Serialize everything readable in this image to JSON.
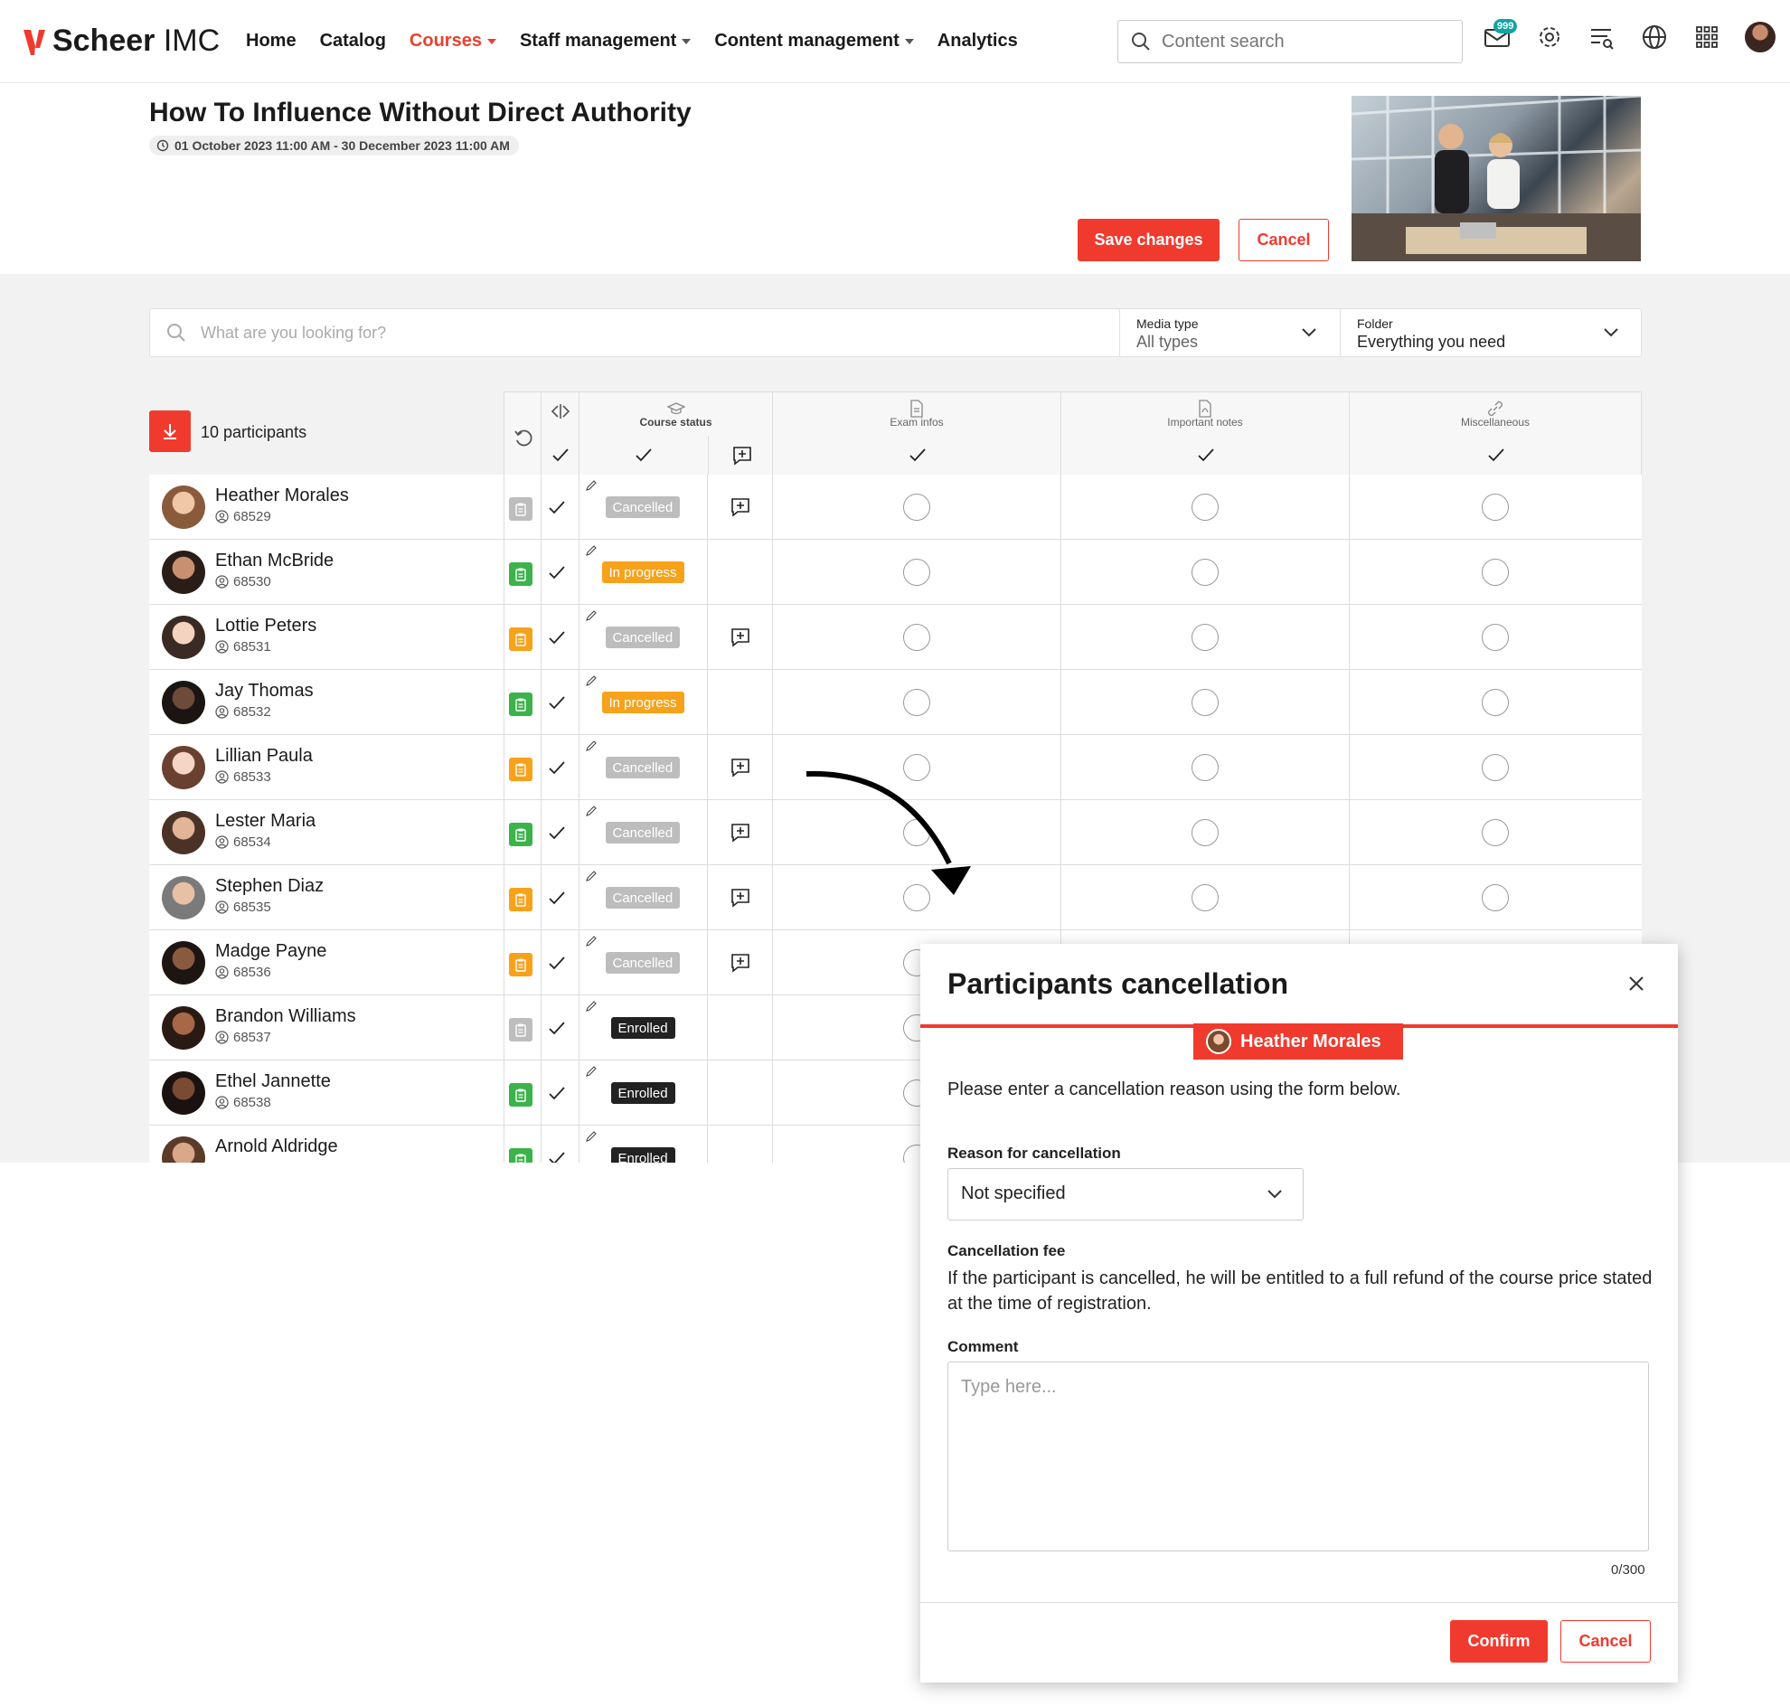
{
  "app": {
    "brand_bold": "Scheer",
    "brand_thin": "IMC",
    "accent": "#f03a2e"
  },
  "nav": [
    "Home",
    "Catalog",
    "Courses",
    "Staff management",
    "Content management",
    "Analytics"
  ],
  "search": {
    "placeholder": "Content search"
  },
  "notifications_badge": "999",
  "course": {
    "title": "How To Influence Without Direct Authority",
    "dates": "01 October 2023 11:00 AM - 30 December 2023 11:00 AM",
    "save_label": "Save changes",
    "cancel_label": "Cancel"
  },
  "filter": {
    "placeholder": "What are you looking for?",
    "media_label": "Media type",
    "media_value": "All types",
    "folder_label": "Folder",
    "folder_value": "Everything you need"
  },
  "participants_count": "10 participants",
  "columns": {
    "status": "Course status",
    "exam": "Exam infos",
    "notes": "Important notes",
    "misc": "Miscellaneous"
  },
  "participants": [
    {
      "name": "Heather Morales",
      "id": "68529",
      "status": "Cancelled",
      "clip": "grey",
      "note": true
    },
    {
      "name": "Ethan McBride",
      "id": "68530",
      "status": "In progress",
      "clip": "green",
      "note": false
    },
    {
      "name": "Lottie Peters",
      "id": "68531",
      "status": "Cancelled",
      "clip": "orange",
      "note": true
    },
    {
      "name": "Jay Thomas",
      "id": "68532",
      "status": "In progress",
      "clip": "green",
      "note": false
    },
    {
      "name": "Lillian Paula",
      "id": "68533",
      "status": "Cancelled",
      "clip": "orange",
      "note": true
    },
    {
      "name": "Lester Maria",
      "id": "68534",
      "status": "Cancelled",
      "clip": "green",
      "note": true
    },
    {
      "name": "Stephen Diaz",
      "id": "68535",
      "status": "Cancelled",
      "clip": "orange",
      "note": true
    },
    {
      "name": "Madge Payne",
      "id": "68536",
      "status": "Cancelled",
      "clip": "orange",
      "note": true
    },
    {
      "name": "Brandon Williams",
      "id": "68537",
      "status": "Enrolled",
      "clip": "grey",
      "note": false
    },
    {
      "name": "Ethel Jannette",
      "id": "68538",
      "status": "Enrolled",
      "clip": "green",
      "note": false
    },
    {
      "name": "Arnold Aldridge",
      "id": "",
      "status": "Enrolled",
      "clip": "green",
      "note": false
    }
  ],
  "modal": {
    "title": "Participants cancellation",
    "participant": "Heather Morales",
    "intro": "Please enter a cancellation reason using the form below.",
    "reason_label": "Reason for cancellation",
    "reason_value": "Not specified",
    "fee_label": "Cancellation fee",
    "fee_text": "If the participant is cancelled, he will be entitled to a full refund of the course price stated at the time of registration.",
    "comment_label": "Comment",
    "comment_placeholder": "Type here...",
    "comment_count": "0/300",
    "confirm_label": "Confirm",
    "cancel_label": "Cancel"
  }
}
